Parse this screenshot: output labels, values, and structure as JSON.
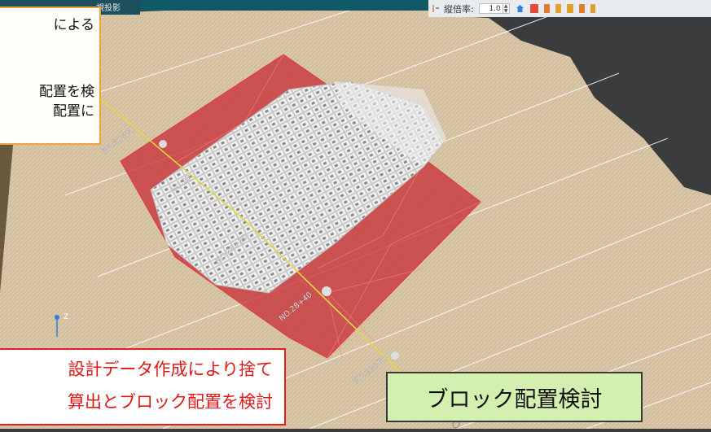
{
  "header": {
    "view_tab_fragment": "視投影"
  },
  "toolbar": {
    "vertical_scale_label": "縦倍率:",
    "vertical_scale_value": "1.0"
  },
  "callouts": {
    "top_left_lines": [
      "による",
      "配置を検",
      "配置に"
    ],
    "bottom_left_lines": [
      "設計データ作成により捨て",
      "算出とブロック配置を検討"
    ],
    "bottom_right_label": "ブロック配置検討"
  },
  "stations": [
    "NO.27+80",
    "NO.28",
    "NO.28+20",
    "NO.28+40",
    "NO.28+60"
  ],
  "axis_label": "Z",
  "colors": {
    "terrain": "#d9c6a8",
    "cut_area": "#c8323a",
    "blocks": "#e4e4e4",
    "centerline": "#e6d640",
    "callout_orange": "#f0a23c",
    "callout_red": "#e02020",
    "label_green": "#d3f0b0"
  }
}
